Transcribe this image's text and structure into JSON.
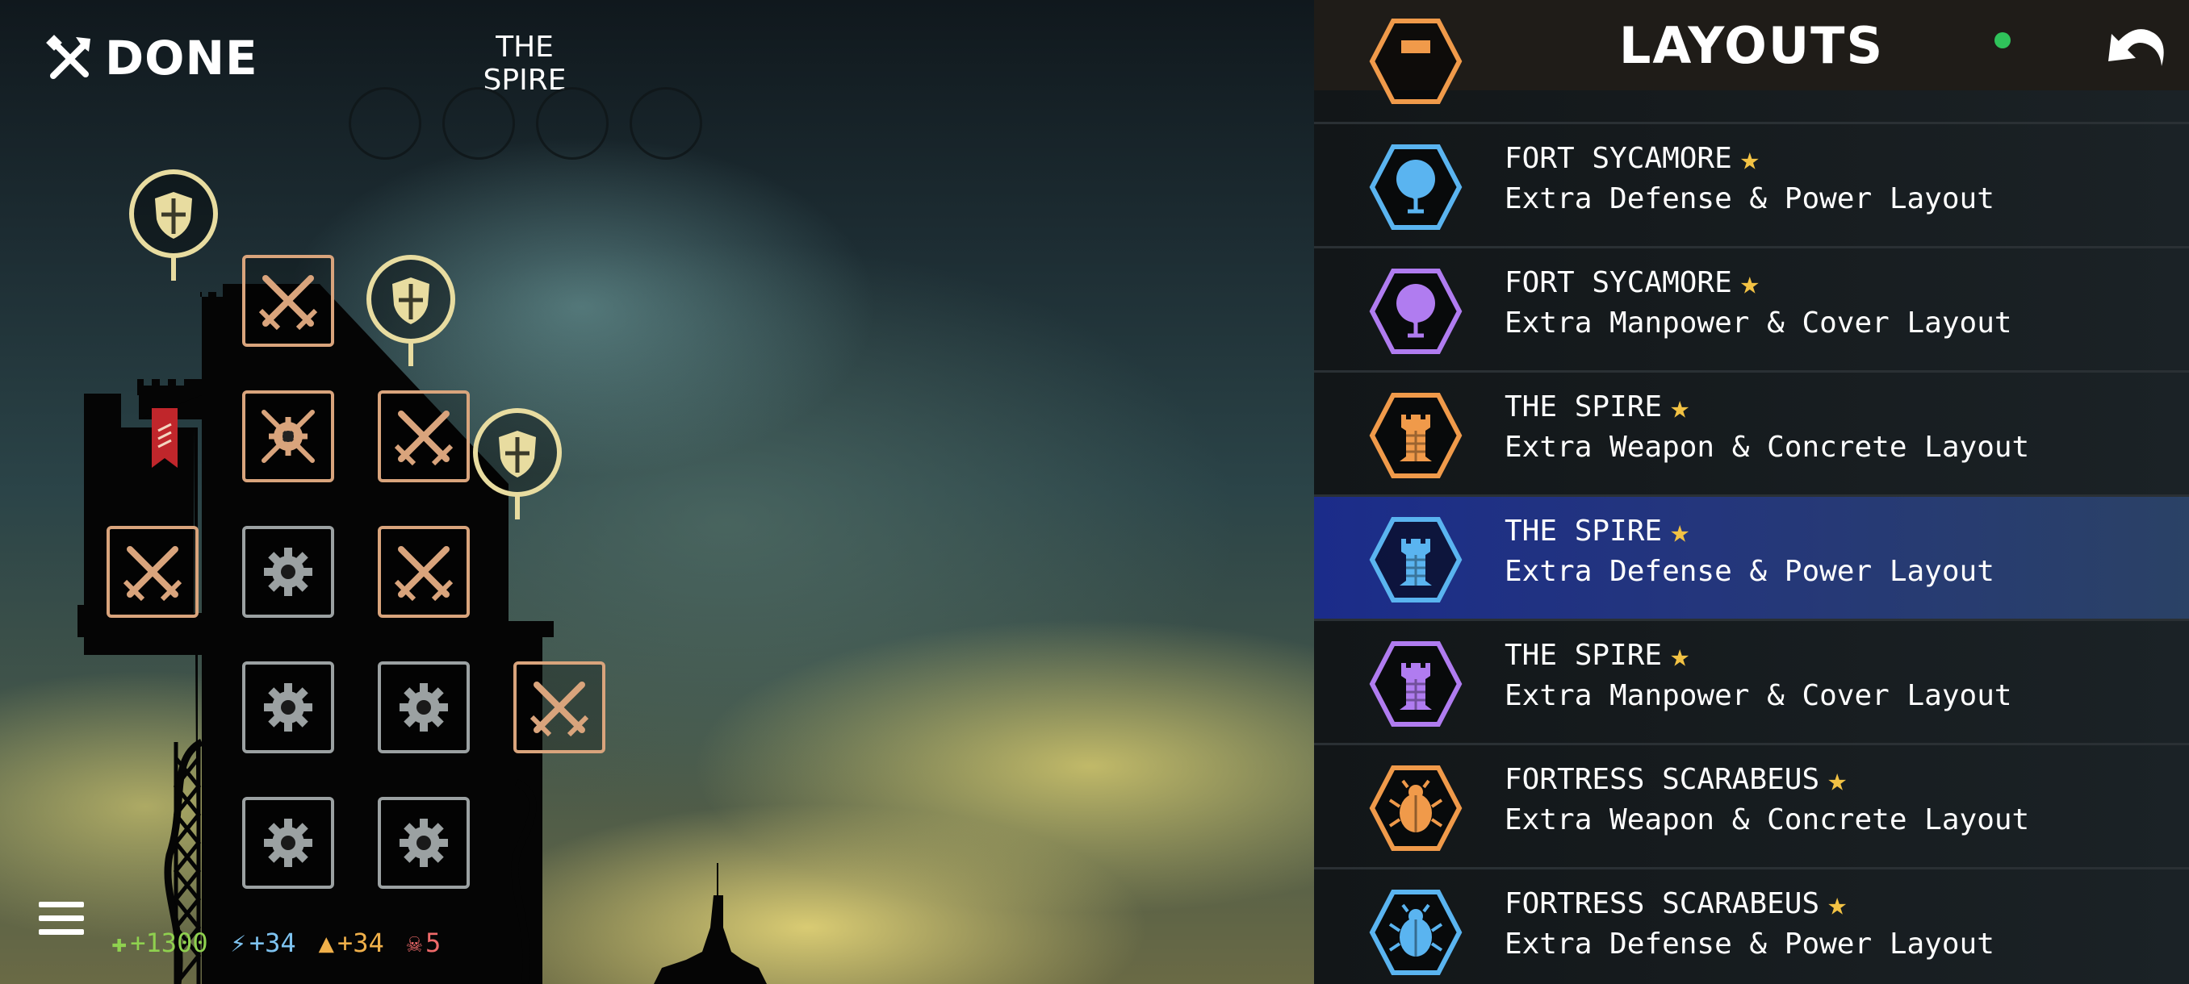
{
  "header": {
    "done_label": "DONE",
    "level_name": "THE SPIRE"
  },
  "resources": {
    "health": "+1300",
    "power": "+34",
    "manpower": "+34",
    "skulls": "5"
  },
  "colors": {
    "weapon": "#d9a47c",
    "gear": "#9ba1a2",
    "defense": "#e8dca0",
    "orange_hex": "#f09a4a",
    "blue_hex": "#5ab4f0",
    "purple_hex": "#b07cf0",
    "selected_row": "#1b2c8a",
    "star": "#f2c244",
    "status_dot": "#2fc25a"
  },
  "panel": {
    "title": "LAYOUTS",
    "items": [
      {
        "icon": "orange-tower-icon",
        "color": "orange",
        "title": "",
        "subtitle": "",
        "partial": true
      },
      {
        "icon": "tree-icon",
        "color": "blue",
        "title": "FORT SYCAMORE",
        "subtitle": "Extra Defense & Power Layout",
        "selected": false
      },
      {
        "icon": "tree-icon",
        "color": "purple",
        "title": "FORT SYCAMORE",
        "subtitle": "Extra Manpower & Cover Layout",
        "selected": false
      },
      {
        "icon": "tower-icon",
        "color": "orange",
        "title": "THE SPIRE",
        "subtitle": "Extra Weapon & Concrete Layout",
        "selected": false
      },
      {
        "icon": "tower-icon",
        "color": "blue",
        "title": "THE SPIRE",
        "subtitle": "Extra Defense & Power Layout",
        "selected": true
      },
      {
        "icon": "tower-icon",
        "color": "purple",
        "title": "THE SPIRE",
        "subtitle": "Extra Manpower & Cover Layout",
        "selected": false
      },
      {
        "icon": "scarab-icon",
        "color": "orange",
        "title": "FORTRESS SCARABEUS",
        "subtitle": "Extra Weapon & Concrete Layout",
        "selected": false
      },
      {
        "icon": "scarab-icon",
        "color": "blue",
        "title": "FORTRESS SCARABEUS",
        "subtitle": "Extra Defense & Power Layout",
        "selected": false
      }
    ]
  }
}
